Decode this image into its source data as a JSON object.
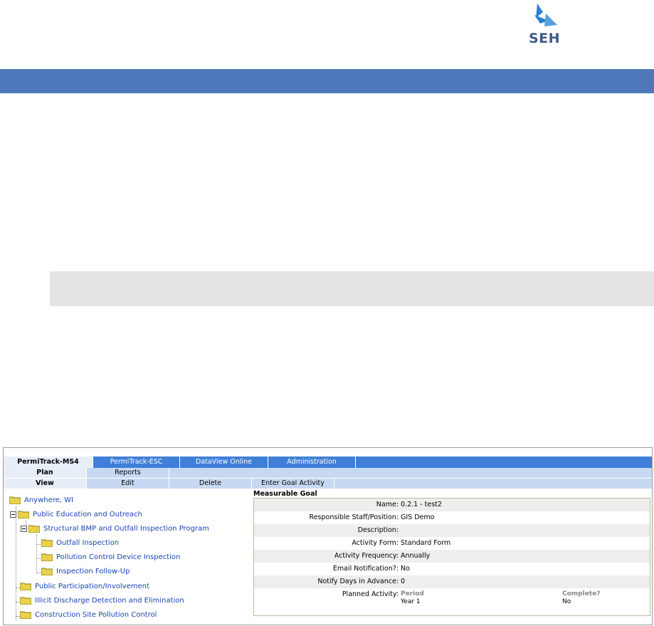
{
  "logo": {
    "text": "SEH"
  },
  "app": {
    "tabs": [
      {
        "label": "PermiTrack-MS4",
        "active": true
      },
      {
        "label": "PermiTrack-ESC",
        "active": false
      },
      {
        "label": "DataView Online",
        "active": false
      },
      {
        "label": "Administration",
        "active": false
      }
    ],
    "subtabs_row1": [
      {
        "label": "Plan",
        "active": true
      },
      {
        "label": "Reports",
        "active": false
      }
    ],
    "subtabs_row2": [
      {
        "label": "View",
        "active": true
      },
      {
        "label": "Edit",
        "active": false
      },
      {
        "label": "Delete",
        "active": false
      },
      {
        "label": "Enter Goal Activity",
        "active": false
      }
    ]
  },
  "tree": {
    "root": "Anywhere, WI",
    "items": [
      "Public Education and Outreach",
      "Structural BMP and Outfall Inspection Program",
      "Outfall Inspection",
      "Pollution Control Device Inspection",
      "Inspection Follow-Up",
      "Public Participation/Involvement",
      "Illicit Discharge Detection and Elimination",
      "Construction Site Pollution Control"
    ]
  },
  "goal": {
    "title": "Measurable Goal",
    "fields": [
      {
        "label": "Name:",
        "value": "0.2.1 - test2"
      },
      {
        "label": "Responsible Staff/Position:",
        "value": "GIS Demo"
      },
      {
        "label": "Description:",
        "value": ""
      },
      {
        "label": "Activity Form:",
        "value": "Standard Form"
      },
      {
        "label": "Activity Frequency:",
        "value": "Annually"
      },
      {
        "label": "Email Notification?:",
        "value": "No"
      },
      {
        "label": "Notify Days in Advance:",
        "value": "0"
      }
    ],
    "planned_label": "Planned Activity:",
    "period_header": "Period",
    "complete_header": "Complete?",
    "period_value": "Year 1",
    "complete_value": "No"
  }
}
